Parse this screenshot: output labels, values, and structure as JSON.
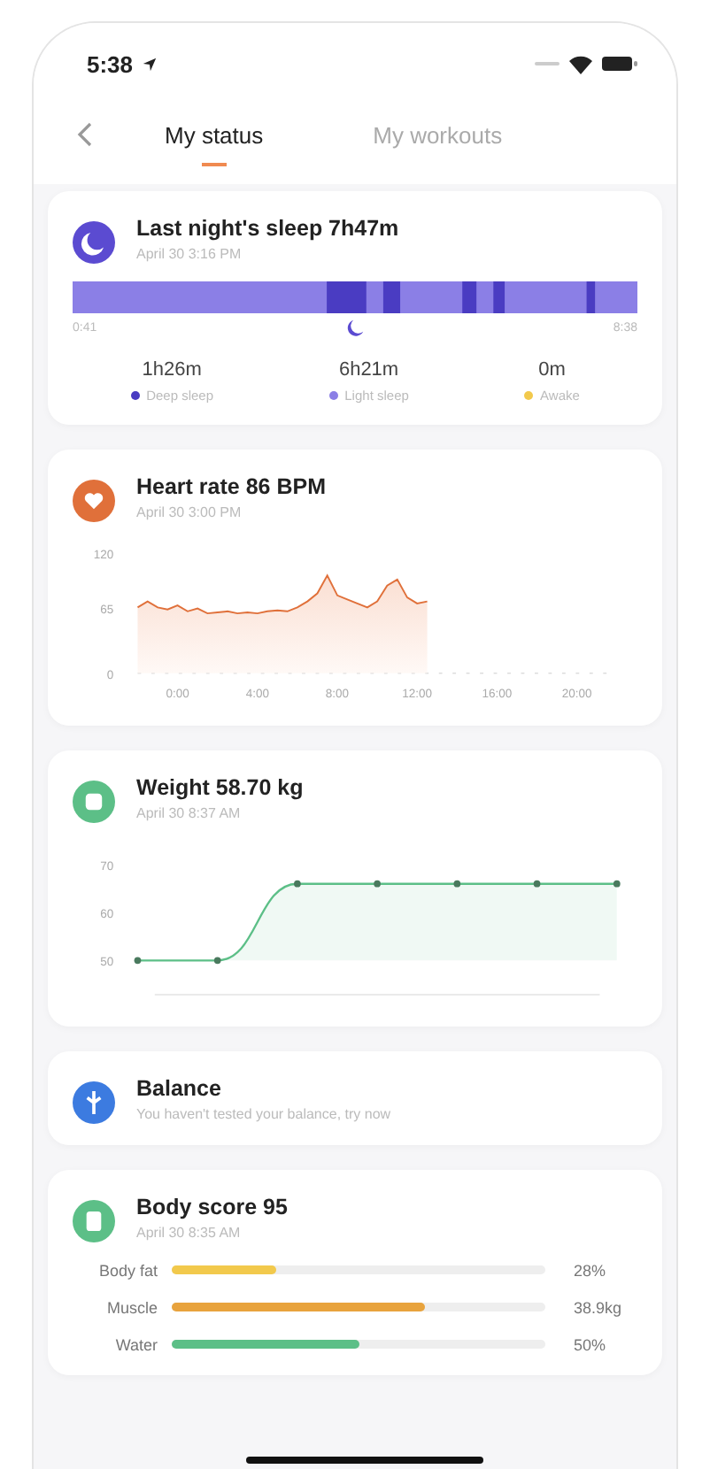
{
  "status_bar": {
    "time": "5:38"
  },
  "tabs": [
    {
      "label": "My status",
      "selected": true
    },
    {
      "label": "My workouts",
      "selected": false
    }
  ],
  "sleep": {
    "title": "Last night's sleep 7h47m",
    "date": "April 30 3:16 PM",
    "start": "0:41",
    "end": "8:38",
    "stats": [
      {
        "value": "1h26m",
        "label": "Deep sleep",
        "color": "#4a3cc2"
      },
      {
        "value": "6h21m",
        "label": "Light sleep",
        "color": "#8b7fe6"
      },
      {
        "value": "0m",
        "label": "Awake",
        "color": "#f2c94c"
      }
    ]
  },
  "heart": {
    "title": "Heart rate 86  BPM",
    "date": "April 30 3:00 PM",
    "chart_data": {
      "type": "area",
      "xlim": [
        -2,
        22
      ],
      "ylim": [
        0,
        120
      ],
      "yticks": [
        0,
        65,
        120
      ],
      "xticks": [
        {
          "value": 0,
          "label": "0:00"
        },
        {
          "value": 4,
          "label": "4:00"
        },
        {
          "value": 8,
          "label": "8:00"
        },
        {
          "value": 12,
          "label": "12:00"
        },
        {
          "value": 16,
          "label": "16:00"
        },
        {
          "value": 20,
          "label": "20:00"
        }
      ],
      "x": [
        -2,
        -1.5,
        -1,
        -0.5,
        0,
        0.5,
        1,
        1.5,
        2,
        2.5,
        3,
        3.5,
        4,
        4.5,
        5,
        5.5,
        6,
        6.5,
        7,
        7.5,
        8,
        8.5,
        9,
        9.5,
        10,
        10.5,
        11,
        11.5,
        12,
        12.5
      ],
      "series": [
        {
          "color": "#e0703a",
          "values": [
            66,
            72,
            66,
            64,
            68,
            62,
            65,
            60,
            61,
            62,
            60,
            61,
            60,
            62,
            63,
            62,
            66,
            72,
            80,
            98,
            78,
            74,
            70,
            66,
            72,
            88,
            94,
            76,
            70,
            72
          ]
        }
      ]
    }
  },
  "weight": {
    "title": "Weight 58.70 kg",
    "date": "April 30 8:37 AM",
    "chart_data": {
      "type": "area",
      "ylim": [
        50,
        70
      ],
      "yticks": [
        50,
        60,
        70
      ],
      "series": [
        {
          "color": "#5cbf87",
          "marker": true,
          "values": [
            50,
            50,
            66,
            66,
            66,
            66,
            66
          ]
        }
      ]
    }
  },
  "balance": {
    "title": "Balance",
    "subtitle": "You haven't tested your balance, try now"
  },
  "body_score": {
    "title": "Body score 95",
    "date": "April 30 8:35 AM",
    "rows": [
      {
        "label": "Body fat",
        "value": "28%",
        "level": 0.28,
        "color": "#f2c94c"
      },
      {
        "label": "Muscle",
        "value": "38.9kg",
        "level": 0.68,
        "color": "#e8a33d"
      },
      {
        "label": "Water",
        "value": "50%",
        "level": 0.5,
        "color": "#5cbf87"
      }
    ]
  }
}
